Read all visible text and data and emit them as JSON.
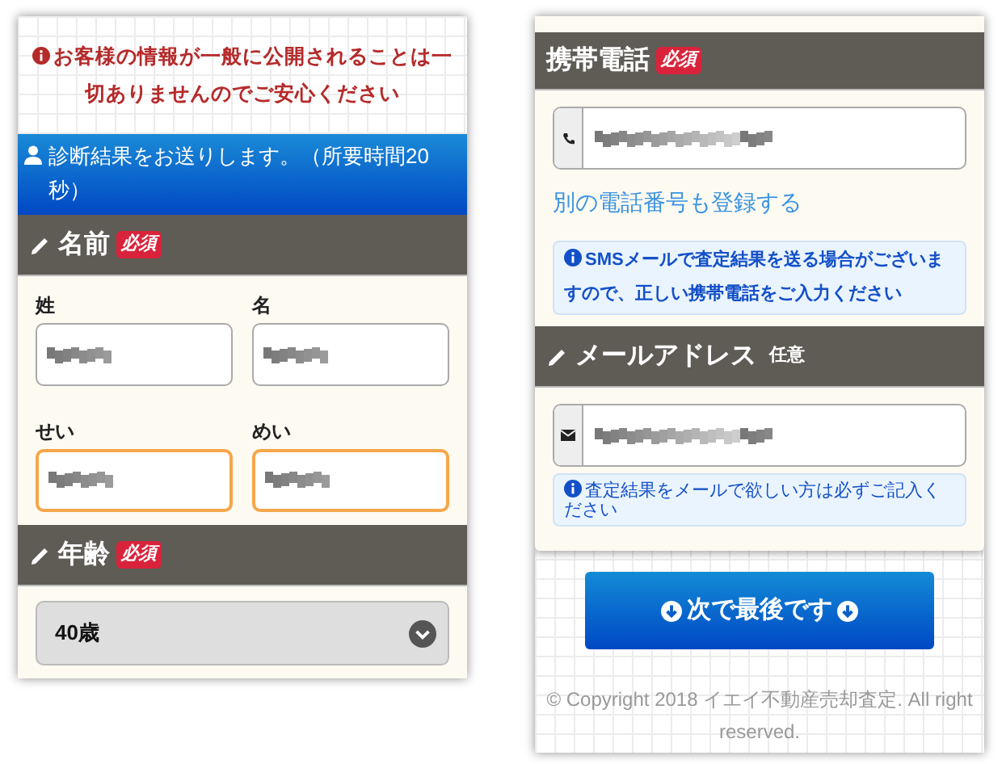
{
  "left_screen": {
    "notice": "お客様の情報が一般に公開されることは一切ありませんのでご安心ください",
    "info_bar": "診断結果をお送りします。（所要時間20秒）",
    "name_section": {
      "title": "名前",
      "badge": {
        "kind": "required",
        "text": "必須"
      },
      "fields": [
        {
          "label": "姓",
          "highlighted": false,
          "masked": true
        },
        {
          "label": "名",
          "highlighted": false,
          "masked": true
        },
        {
          "label": "せい",
          "highlighted": true,
          "masked": true
        },
        {
          "label": "めい",
          "highlighted": true,
          "masked": true
        }
      ]
    },
    "age_section": {
      "title": "年齢",
      "badge": {
        "kind": "required",
        "text": "必須"
      },
      "select_value": "40歳"
    }
  },
  "right_screen": {
    "phone_section": {
      "title": "携帯電話",
      "badge": {
        "kind": "required",
        "text": "必須"
      },
      "masked": true,
      "link": "別の電話番号も登録する",
      "info": "SMSメールで査定結果を送る場合がございますので、正しい携帯電話をご入力ください"
    },
    "email_section": {
      "title": "メールアドレス",
      "badge": {
        "kind": "optional",
        "text": "任意"
      },
      "masked": true,
      "info": "査定結果をメールで欲しい方は必ずご記入ください"
    },
    "next_button": "次で最後です",
    "copyright": "© Copyright 2018 イエイ不動産売却査定. All right reserved."
  }
}
